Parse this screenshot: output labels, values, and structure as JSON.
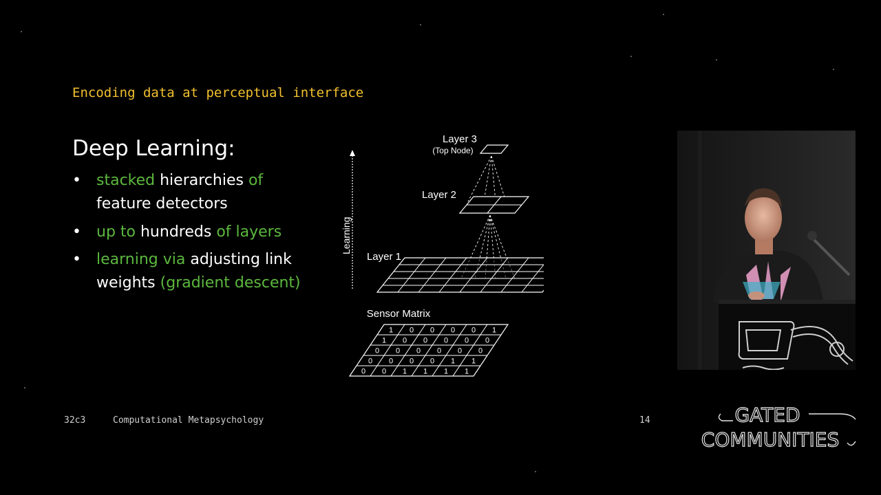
{
  "slide": {
    "title": "Encoding data at perceptual interface",
    "heading": "Deep Learning:",
    "bullets": [
      {
        "line1": [
          {
            "t": "stacked",
            "c": "g"
          },
          {
            "t": " hierarchies ",
            "c": "w"
          },
          {
            "t": "of",
            "c": "g"
          }
        ],
        "line2": [
          {
            "t": "feature detectors",
            "c": "w"
          }
        ]
      },
      {
        "line1": [
          {
            "t": "up to",
            "c": "g"
          },
          {
            "t": " hundreds ",
            "c": "w"
          },
          {
            "t": "of layers",
            "c": "g"
          }
        ]
      },
      {
        "line1": [
          {
            "t": "learning via",
            "c": "g"
          },
          {
            "t": " adjusting link",
            "c": "w"
          }
        ],
        "line2": [
          {
            "t": "weights ",
            "c": "w"
          },
          {
            "t": "(gradient descent)",
            "c": "g"
          }
        ]
      }
    ],
    "bullet_symbol": "•"
  },
  "diagram": {
    "layer3_label": "Layer 3",
    "layer3_sub": "(Top Node)",
    "layer2_label": "Layer 2",
    "layer1_label": "Layer 1",
    "learning_label": "Learning",
    "sensor_label": "Sensor Matrix",
    "sensor_rows": [
      [
        "1",
        "0",
        "0",
        "0",
        "0",
        "1"
      ],
      [
        "1",
        "0",
        "0",
        "0",
        "0",
        "0"
      ],
      [
        "0",
        "0",
        "0",
        "0",
        "0",
        "0"
      ],
      [
        "0",
        "0",
        "0",
        "0",
        "1",
        "1"
      ],
      [
        "0",
        "0",
        "1",
        "1",
        "1",
        "1"
      ]
    ]
  },
  "footer": {
    "event": "32c3",
    "talk": "Computational Metapsychology",
    "page": "14"
  },
  "logo": {
    "line1": "GATED",
    "line2": "COMMUNITIES"
  },
  "colors": {
    "title": "#f2c12e",
    "accent_green": "#5cb83e",
    "text": "#ffffff",
    "background": "#000000"
  }
}
